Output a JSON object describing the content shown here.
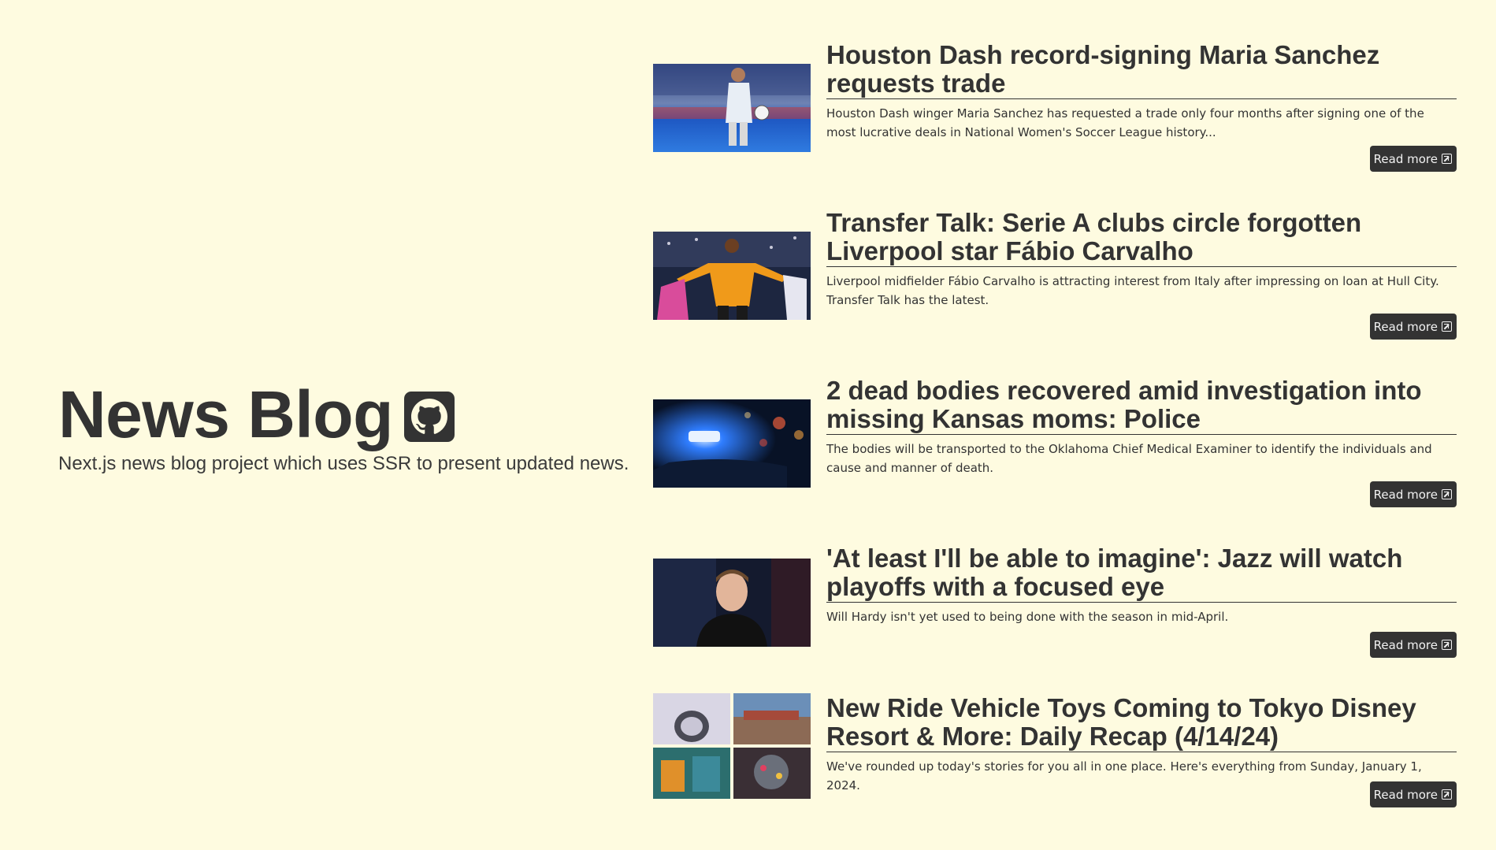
{
  "hero": {
    "title": "News Blog",
    "subtitle": "Next.js news blog project which uses SSR to present updated news.",
    "github_icon": "github-icon"
  },
  "articles": [
    {
      "title": "Houston Dash record-signing Maria Sanchez requests trade",
      "description": "Houston Dash winger Maria Sanchez has requested a trade only four months after signing one of the most lucrative deals in National Women's Soccer League history...",
      "button_label": "Read more"
    },
    {
      "title": "Transfer Talk: Serie A clubs circle forgotten Liverpool star Fábio Carvalho",
      "description": "Liverpool midfielder Fábio Carvalho is attracting interest from Italy after impressing on loan at Hull City. Transfer Talk has the latest.",
      "button_label": "Read more"
    },
    {
      "title": "2 dead bodies recovered amid investigation into missing Kansas moms: Police",
      "description": "The bodies will be transported to the Oklahoma Chief Medical Examiner to identify the individuals and cause and manner of death.",
      "button_label": "Read more"
    },
    {
      "title": "'At least I'll be able to imagine': Jazz will watch playoffs with a focused eye",
      "description": "Will Hardy isn't yet used to being done with the season in mid-April.",
      "button_label": "Read more"
    },
    {
      "title": "New Ride Vehicle Toys Coming to Tokyo Disney Resort & More: Daily Recap (4/14/24)",
      "description": "We've rounded up today's stories for you all in one place. Here's everything from Sunday, January 1, 2024.",
      "button_label": "Read more"
    }
  ],
  "colors": {
    "background": "#fefbe0",
    "text": "#333333",
    "button": "#333333"
  }
}
